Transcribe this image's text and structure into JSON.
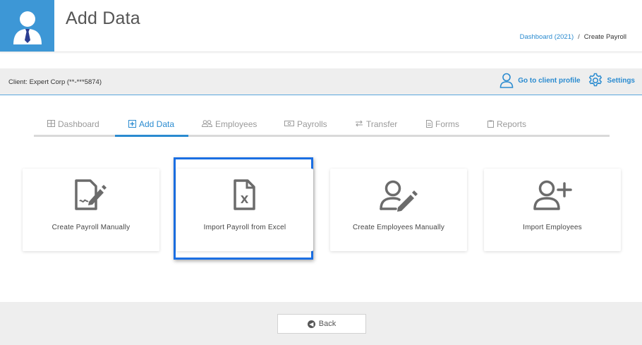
{
  "header": {
    "title": "Add Data",
    "breadcrumb": {
      "parent": "Dashboard (2021)",
      "separator": "/",
      "current": "Create Payroll"
    }
  },
  "client_bar": {
    "client_label": "Client: Expert Corp (**-***5874)",
    "profile_link": "Go to client profile",
    "settings_link": "Settings"
  },
  "tabs": [
    {
      "label": "Dashboard",
      "icon": "table-icon",
      "active": false
    },
    {
      "label": "Add Data",
      "icon": "plus-square-icon",
      "active": true
    },
    {
      "label": "Employees",
      "icon": "users-icon",
      "active": false
    },
    {
      "label": "Payrolls",
      "icon": "money-icon",
      "active": false
    },
    {
      "label": "Transfer",
      "icon": "exchange-icon",
      "active": false
    },
    {
      "label": "Forms",
      "icon": "document-icon",
      "active": false
    },
    {
      "label": "Reports",
      "icon": "clipboard-icon",
      "active": false
    }
  ],
  "cards": [
    {
      "label": "Create Payroll Manually",
      "icon": "file-signature-icon"
    },
    {
      "label": "Import Payroll from Excel",
      "icon": "file-excel-icon"
    },
    {
      "label": "Create Employees Manually",
      "icon": "user-edit-icon"
    },
    {
      "label": "Import Employees",
      "icon": "user-plus-icon"
    }
  ],
  "footer": {
    "back_label": "Back"
  },
  "colors": {
    "accent": "#2a8bd0",
    "highlight": "#1b6fe3",
    "avatar_bg": "#3d97d6",
    "icon_gray": "#6b6b6b"
  }
}
